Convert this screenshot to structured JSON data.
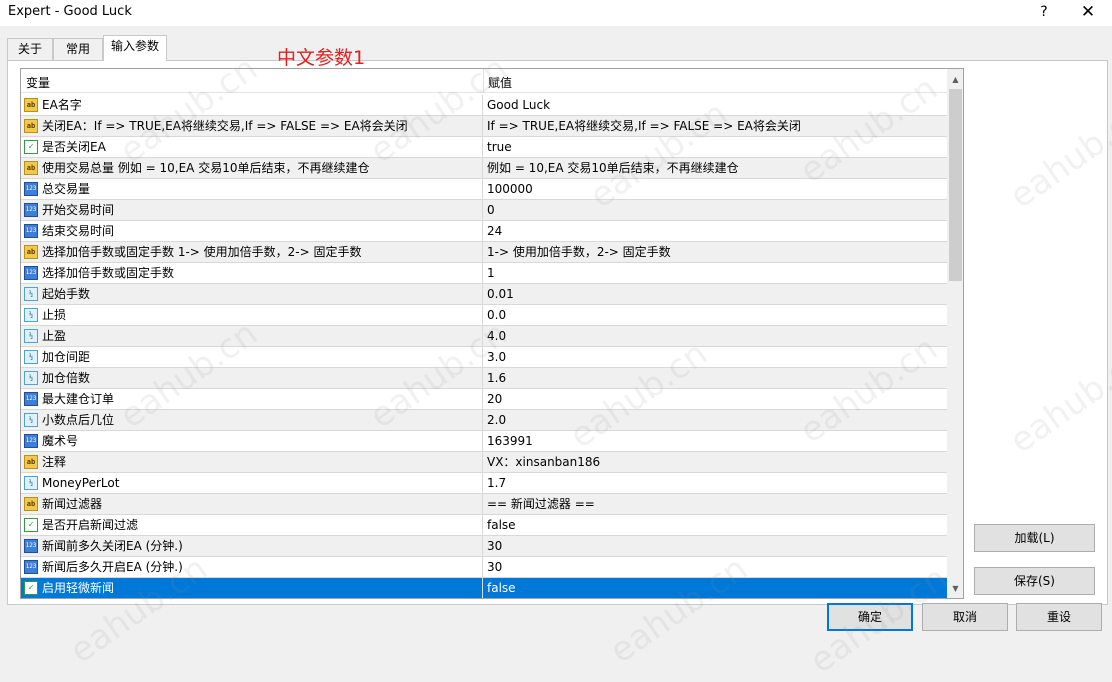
{
  "window": {
    "title": "Expert - Good Luck",
    "help_label": "?",
    "close_label": "✕"
  },
  "tabs": [
    {
      "label": "关于"
    },
    {
      "label": "常用"
    },
    {
      "label": "输入参数"
    }
  ],
  "annotation": "中文参数1",
  "grid": {
    "columns": [
      "变量",
      "赋值"
    ],
    "rows": [
      {
        "type": "ab",
        "icon": "ab",
        "variable": "EA名字",
        "value": "Good Luck"
      },
      {
        "type": "ab",
        "icon": "ab",
        "variable": "关闭EA：If => TRUE,EA将继续交易,If => FALSE => EA将会关闭",
        "value": "If => TRUE,EA将继续交易,If => FALSE => EA将会关闭"
      },
      {
        "type": "bool",
        "icon": "✓",
        "variable": "是否关闭EA",
        "value": "true"
      },
      {
        "type": "ab",
        "icon": "ab",
        "variable": "使用交易总量 例如 = 10,EA 交易10单后结束，不再继续建仓",
        "value": "例如 = 10,EA 交易10单后结束，不再继续建仓"
      },
      {
        "type": "123",
        "icon": "123",
        "variable": "总交易量",
        "value": "100000"
      },
      {
        "type": "123",
        "icon": "123",
        "variable": "开始交易时间",
        "value": "0"
      },
      {
        "type": "123",
        "icon": "123",
        "variable": "结束交易时间",
        "value": "24"
      },
      {
        "type": "ab",
        "icon": "ab",
        "variable": "选择加倍手数或固定手数  1-> 使用加倍手数，2-> 固定手数",
        "value": "1-> 使用加倍手数，2-> 固定手数"
      },
      {
        "type": "123",
        "icon": "123",
        "variable": "选择加倍手数或固定手数",
        "value": "1"
      },
      {
        "type": "frac",
        "icon": "½",
        "variable": "起始手数",
        "value": "0.01"
      },
      {
        "type": "frac",
        "icon": "½",
        "variable": "止损",
        "value": "0.0"
      },
      {
        "type": "frac",
        "icon": "½",
        "variable": "止盈",
        "value": "4.0"
      },
      {
        "type": "frac",
        "icon": "½",
        "variable": "加仓间距",
        "value": "3.0"
      },
      {
        "type": "frac",
        "icon": "½",
        "variable": "加仓倍数",
        "value": "1.6"
      },
      {
        "type": "123",
        "icon": "123",
        "variable": "最大建仓订单",
        "value": "20"
      },
      {
        "type": "frac",
        "icon": "½",
        "variable": "小数点后几位",
        "value": "2.0"
      },
      {
        "type": "123",
        "icon": "123",
        "variable": "魔术号",
        "value": "163991"
      },
      {
        "type": "ab",
        "icon": "ab",
        "variable": "注释",
        "value": "VX：xinsanban186"
      },
      {
        "type": "frac",
        "icon": "½",
        "variable": "MoneyPerLot",
        "value": "1.7"
      },
      {
        "type": "ab",
        "icon": "ab",
        "variable": "新闻过滤器",
        "value": "== 新闻过滤器 =="
      },
      {
        "type": "bool",
        "icon": "✓",
        "variable": "是否开启新闻过滤",
        "value": "false"
      },
      {
        "type": "123",
        "icon": "123",
        "variable": "新闻前多久关闭EA (分钟.)",
        "value": "30"
      },
      {
        "type": "123",
        "icon": "123",
        "variable": "新闻后多久开启EA (分钟.)",
        "value": "30"
      },
      {
        "type": "bool",
        "icon": "✓",
        "variable": "启用轻微新闻",
        "value": "false",
        "selected": true
      }
    ]
  },
  "scrollbar": {
    "up_glyph": "▲",
    "down_glyph": "▼"
  },
  "buttons": {
    "load": "加载(L)",
    "save": "保存(S)",
    "ok": "确定",
    "cancel": "取消",
    "reset": "重设"
  },
  "watermark": "eahub.cn",
  "colors": {
    "selection": "#0078d7",
    "annotation": "#e0211f",
    "default_button_border": "#0078d7"
  }
}
